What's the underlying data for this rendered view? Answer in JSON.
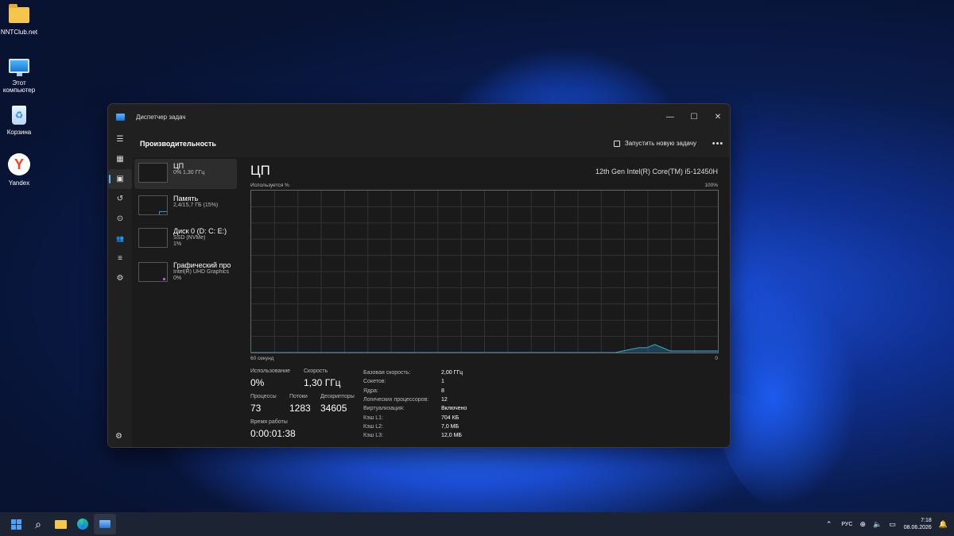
{
  "desktop": {
    "icons": [
      {
        "label": "NNTClub.net",
        "icon": "folder-icon"
      },
      {
        "label": "Этот компьютер",
        "icon": "computer-icon"
      },
      {
        "label": "Корзина",
        "icon": "recycle-bin-icon"
      },
      {
        "label": "Yandex",
        "icon": "yandex-browser-icon"
      }
    ]
  },
  "window": {
    "title": "Диспетчер задач",
    "page_title": "Производительность",
    "run_task_label": "Запустить новую задачу",
    "more_label": "•••",
    "controls": {
      "minimize": "—",
      "maximize": "☐",
      "close": "✕"
    }
  },
  "nav": [
    {
      "name": "menu-icon",
      "glyph": "☰"
    },
    {
      "name": "processes-icon",
      "glyph": "▦"
    },
    {
      "name": "performance-icon",
      "glyph": "▣"
    },
    {
      "name": "app-history-icon",
      "glyph": "↺"
    },
    {
      "name": "startup-apps-icon",
      "glyph": "⊙"
    },
    {
      "name": "users-icon",
      "glyph": "👥"
    },
    {
      "name": "details-icon",
      "glyph": "≡"
    },
    {
      "name": "services-icon",
      "glyph": "⚙"
    }
  ],
  "resources": [
    {
      "name": "ЦП",
      "sub1": "0% 1,30 ГГц",
      "sub2": ""
    },
    {
      "name": "Память",
      "sub1": "2,4/15,7 ГБ (15%)",
      "sub2": ""
    },
    {
      "name": "Диск 0 (D: C: E:)",
      "sub1": "SSD (NVMe)",
      "sub2": "1%"
    },
    {
      "name": "Графический про",
      "sub1": "Intel(R) UHD Graphics",
      "sub2": "0%"
    }
  ],
  "cpu": {
    "title": "ЦП",
    "model": "12th Gen Intel(R) Core(TM) i5-12450H",
    "graph_top_left": "Используется %",
    "graph_top_right": "100%",
    "graph_bottom_left": "60 секунд",
    "graph_bottom_right": "0",
    "usage_history_percent": [
      0,
      0,
      0,
      0,
      0,
      0,
      0,
      0,
      0,
      0,
      0,
      0,
      0,
      0,
      0,
      0,
      0,
      0,
      0,
      0,
      0,
      0,
      0,
      0,
      0,
      0,
      0,
      0,
      0,
      0,
      0,
      0,
      0,
      0,
      0,
      0,
      0,
      0,
      0,
      0,
      0,
      0,
      0,
      0,
      0,
      0,
      0,
      1,
      2,
      3,
      3,
      5,
      3,
      1,
      1,
      1,
      1,
      1,
      1,
      1
    ],
    "stats": {
      "usage_label": "Использование",
      "usage_value": "0%",
      "speed_label": "Скорость",
      "speed_value": "1,30 ГГц",
      "processes_label": "Процессы",
      "processes_value": "73",
      "threads_label": "Потоки",
      "threads_value": "1283",
      "handles_label": "Дескрипторы",
      "handles_value": "34605",
      "uptime_label": "Время работы",
      "uptime_value": "0:00:01:38"
    },
    "info": [
      {
        "k": "Базовая скорость:",
        "v": "2,00 ГГц"
      },
      {
        "k": "Сокетов:",
        "v": "1"
      },
      {
        "k": "Ядра:",
        "v": "8"
      },
      {
        "k": "Логических процессоров:",
        "v": "12"
      },
      {
        "k": "Виртуализация:",
        "v": "Включено"
      },
      {
        "k": "Кэш L1:",
        "v": "704 КБ"
      },
      {
        "k": "Кэш L2:",
        "v": "7,0 МБ"
      },
      {
        "k": "Кэш L3:",
        "v": "12,0 МБ"
      }
    ]
  },
  "taskbar": {
    "lang": "РУС",
    "time": "7:18",
    "date": "08.06.2026"
  }
}
